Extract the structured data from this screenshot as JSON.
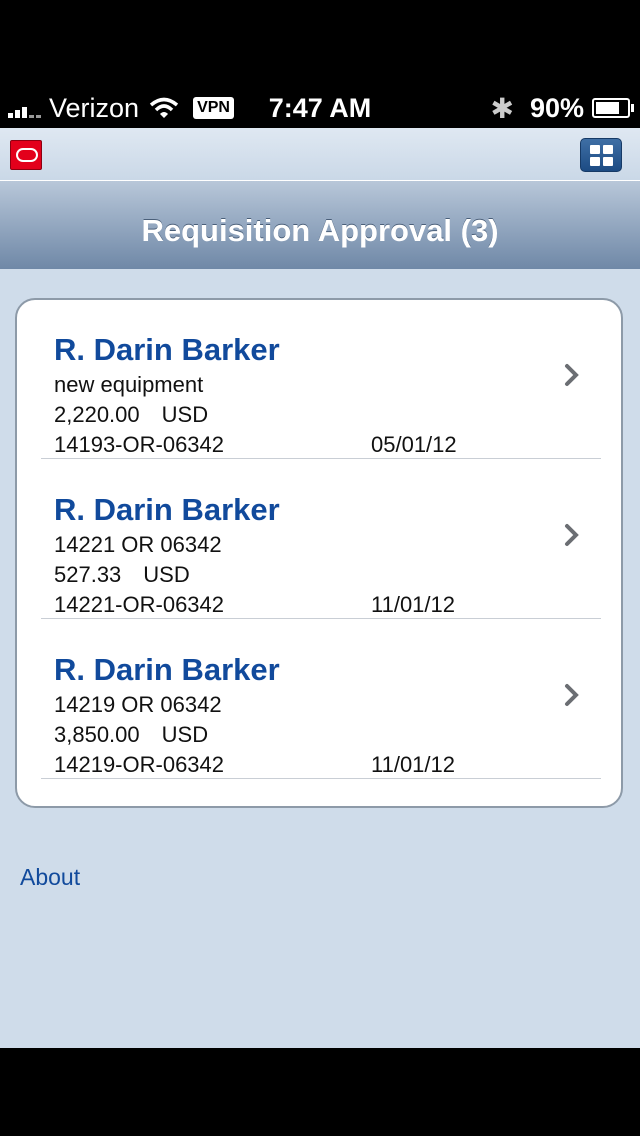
{
  "status_bar": {
    "carrier": "Verizon",
    "vpn": "VPN",
    "time": "7:47 AM",
    "battery_pct": "90%",
    "battery_level": 0.9
  },
  "header": {
    "title": "Requisition Approval (3)"
  },
  "requisitions": [
    {
      "name": "R. Darin Barker",
      "description": "new equipment",
      "amount": "2,220.00",
      "currency": "USD",
      "number": "14193-OR-06342",
      "date": "05/01/12"
    },
    {
      "name": "R. Darin Barker",
      "description": "14221 OR 06342",
      "amount": "527.33",
      "currency": "USD",
      "number": "14221-OR-06342",
      "date": "11/01/12"
    },
    {
      "name": "R. Darin Barker",
      "description": "14219 OR 06342",
      "amount": "3,850.00",
      "currency": "USD",
      "number": "14219-OR-06342",
      "date": "11/01/12"
    }
  ],
  "footer": {
    "about_label": "About"
  },
  "icons": {
    "app_logo": "oracle-logo-icon",
    "menu": "grid-menu-icon",
    "disclosure": "chevron-right-icon"
  },
  "colors": {
    "accent": "#114a9c",
    "background": "#cfdcea",
    "logo": "#e3001b"
  }
}
